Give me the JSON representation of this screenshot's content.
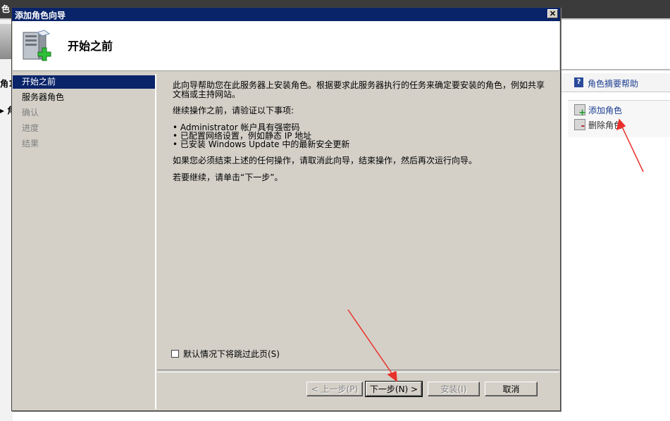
{
  "background_window": {
    "title_fragment": "色",
    "left_labels": [
      "角1",
      "▸ 角"
    ],
    "help_link": "角色摘要帮助",
    "actions": [
      "添加角色",
      "删除角色"
    ]
  },
  "wizard": {
    "title": "添加角色向导",
    "close_label": "✕",
    "header_title": "开始之前",
    "nav": [
      {
        "label": "开始之前",
        "state": "active"
      },
      {
        "label": "服务器角色",
        "state": "normal"
      },
      {
        "label": "确认",
        "state": "disabled"
      },
      {
        "label": "进度",
        "state": "disabled"
      },
      {
        "label": "结果",
        "state": "disabled"
      }
    ],
    "content": {
      "intro": "此向导帮助您在此服务器上安装角色。根据要求此服务器执行的任务来确定要安装的角色，例如共享文档或主持网站。",
      "before": "继续操作之前，请验证以下事项:",
      "bullets": [
        "• Administrator 帐户具有强密码",
        "• 已配置网络设置，例如静态 IP 地址",
        "• 已安装 Windows Update 中的最新安全更新"
      ],
      "cancel_note": "如果您必须结束上述的任何操作，请取消此向导，结束操作，然后再次运行向导。",
      "continue_note": "若要继续，请单击“下一步”。",
      "skip_label": "默认情况下将跳过此页(S)"
    },
    "buttons": {
      "prev": "< 上一步(P)",
      "next": "下一步(N) >",
      "install": "安装(I)",
      "cancel": "取消"
    }
  },
  "colors": {
    "titlebar": "#0a246a",
    "dialog_face": "#d4d0c8",
    "annotation_arrow": "#e8312a",
    "link": "#1a3d8f"
  }
}
